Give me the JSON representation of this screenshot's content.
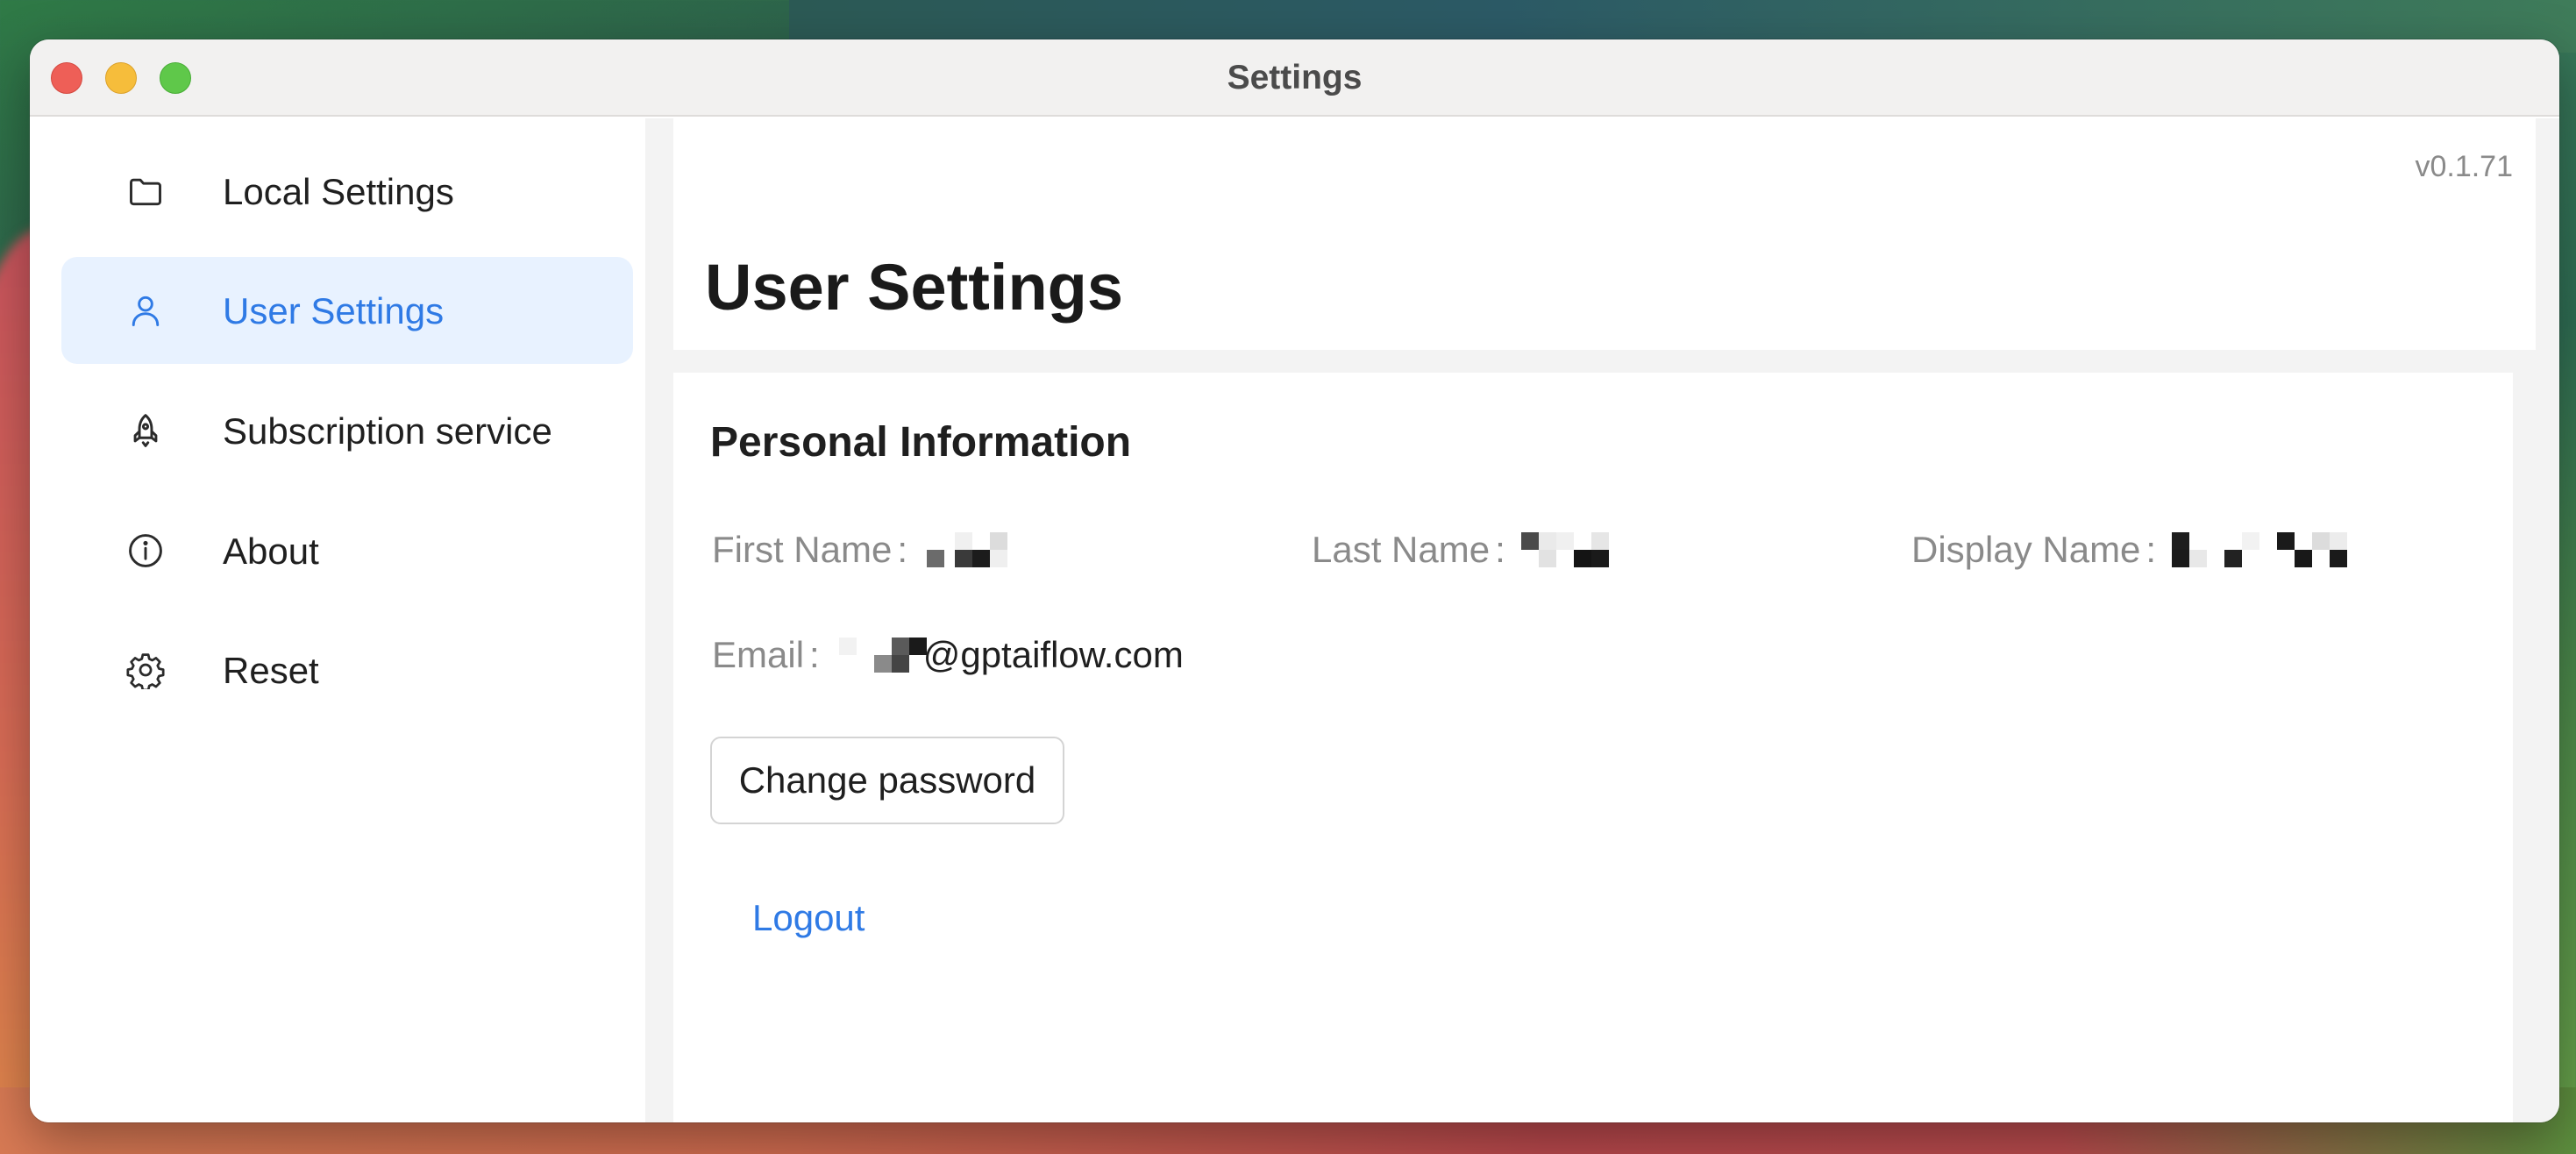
{
  "window": {
    "title": "Settings"
  },
  "sidebar": {
    "items": [
      {
        "label": "Local Settings",
        "icon": "folder-icon",
        "active": false
      },
      {
        "label": "User Settings",
        "icon": "user-icon",
        "active": true
      },
      {
        "label": "Subscription service",
        "icon": "rocket-icon",
        "active": false
      },
      {
        "label": "About",
        "icon": "info-icon",
        "active": false
      },
      {
        "label": "Reset",
        "icon": "gear-icon",
        "active": false
      }
    ]
  },
  "header": {
    "version": "v0.1.71",
    "title": "User Settings"
  },
  "personal_info": {
    "title": "Personal Information",
    "first_name_label": "First Name",
    "last_name_label": "Last Name",
    "display_name_label": "Display Name",
    "email_label": "Email",
    "email_domain": "@gptaiflow.com",
    "colon": ":"
  },
  "actions": {
    "change_password": "Change password",
    "logout": "Logout"
  },
  "colors": {
    "accent": "#2f7ae5",
    "active_bg": "#e8f2ff"
  }
}
